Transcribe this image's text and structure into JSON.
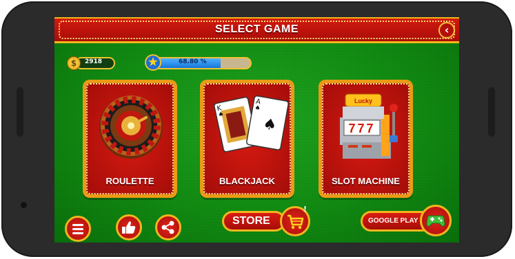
{
  "header": {
    "title": "SELECT GAME",
    "back_icon": "back-arrow-icon"
  },
  "stats": {
    "coins": "2918",
    "level_icon": "star-icon",
    "progress_label": "68.80 %",
    "progress_fraction": 0.688
  },
  "games": [
    {
      "label": "ROULETTE",
      "icon": "roulette-wheel-icon"
    },
    {
      "label": "BLACKJACK",
      "icon": "playing-cards-icon"
    },
    {
      "label": "SLOT MACHINE",
      "icon": "slot-machine-icon",
      "sign": "Lucky",
      "reels": "777"
    }
  ],
  "footer": {
    "store_label": "STORE",
    "store_badge": "!",
    "google_play_label": "GOOGLE PLAY"
  },
  "colors": {
    "felt": "#118a12",
    "red": "#c4120c",
    "gold": "#f2b51f"
  }
}
